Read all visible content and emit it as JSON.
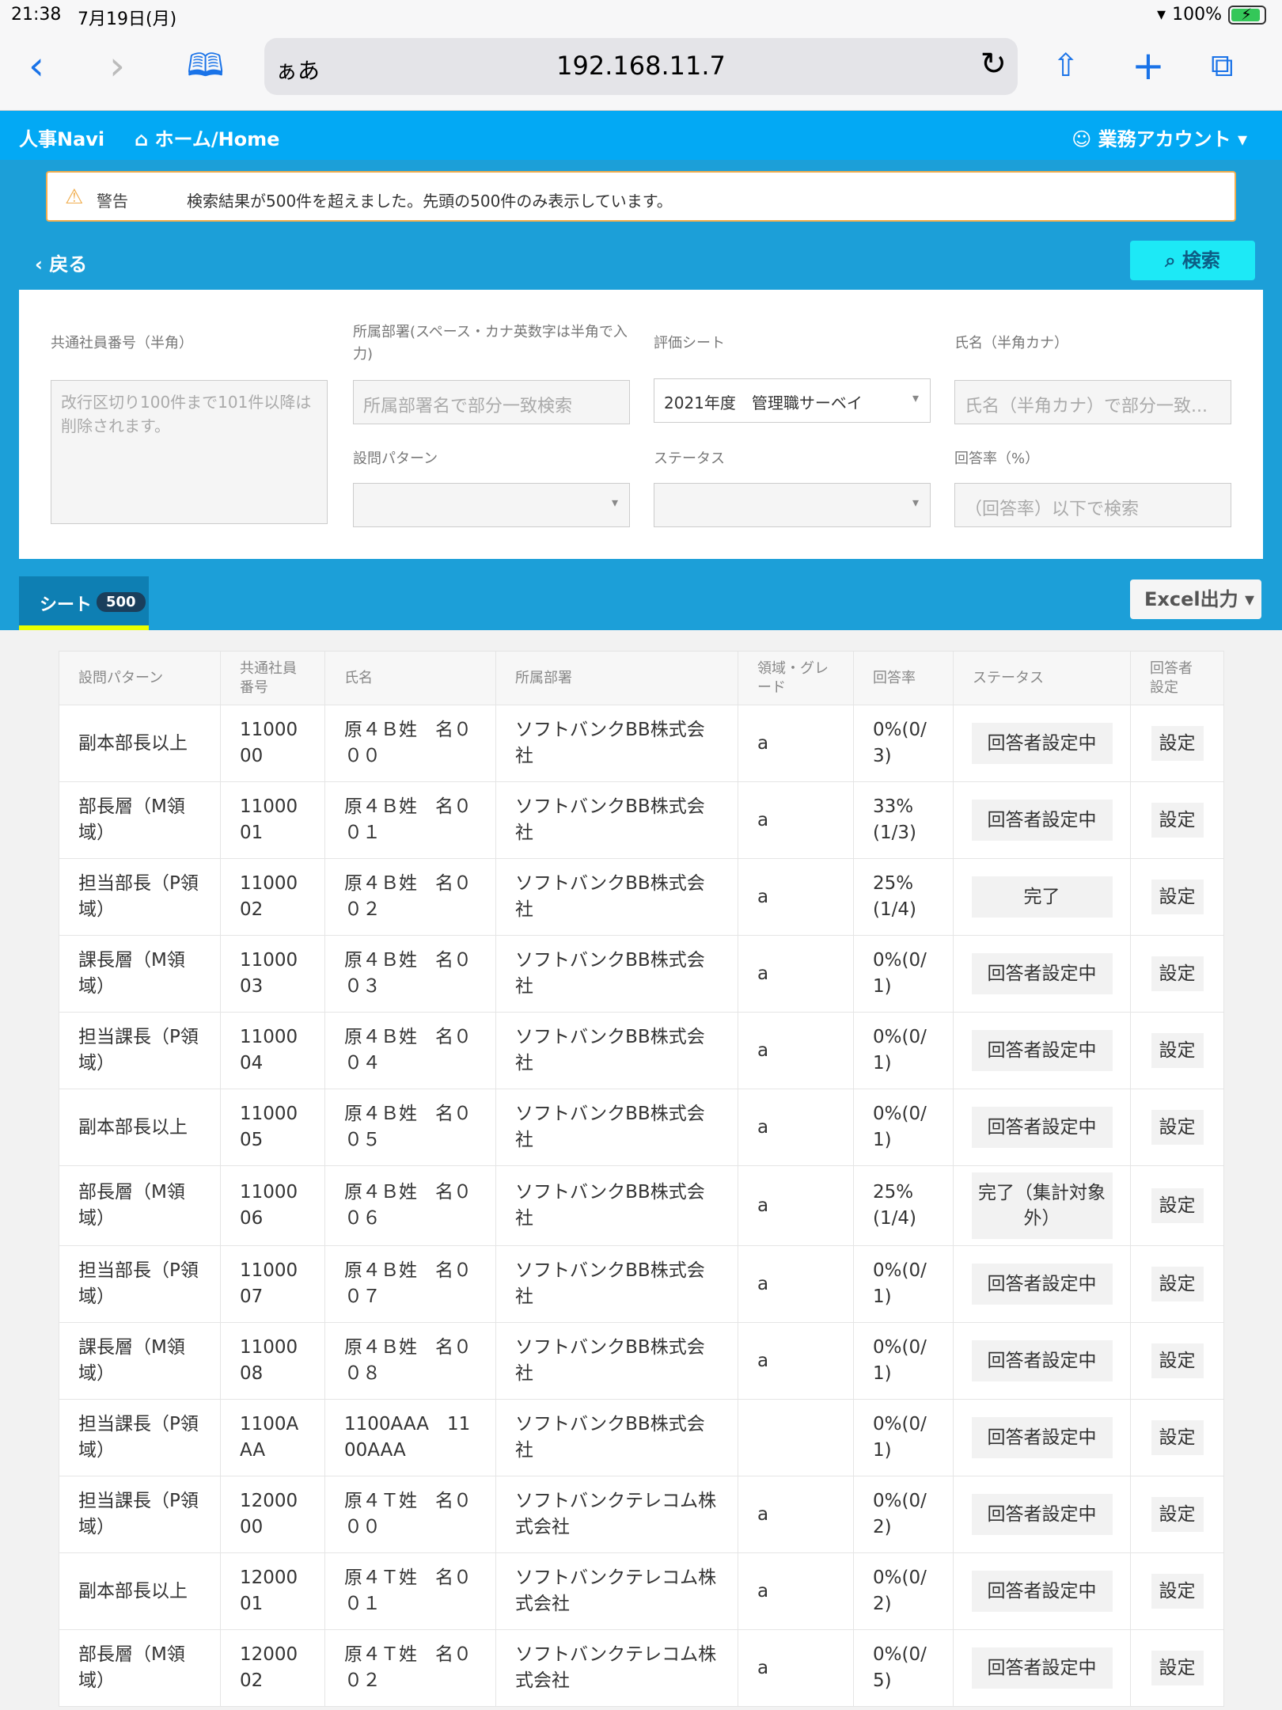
{
  "statusbar": {
    "time": "21:38",
    "date": "7月19日(月)",
    "battery": "100%"
  },
  "browser": {
    "aa": "ぁあ",
    "url": "192.168.11.7"
  },
  "nav": {
    "brand": "人事Navi",
    "home": "ホーム/Home",
    "account": "業務アカウント"
  },
  "alert": {
    "label": "警告",
    "message": "検索結果が500件を超えました。先頭の500件のみ表示しています。"
  },
  "actions": {
    "back": "戻る",
    "search": "検索",
    "excel": "Excel出力"
  },
  "form": {
    "employee_no": {
      "label": "共通社員番号（半角）",
      "placeholder": "改行区切り100件まで101件以降は削除されます。"
    },
    "department": {
      "label": "所属部署(スペース・カナ英数字は半角で入力)",
      "placeholder": "所属部署名で部分一致検索"
    },
    "sheet": {
      "label": "評価シート",
      "value": "2021年度　管理職サーベイ"
    },
    "name": {
      "label": "氏名（半角カナ）",
      "placeholder": "氏名（半角カナ）で部分一致..."
    },
    "pattern": {
      "label": "設問パターン",
      "value": ""
    },
    "status": {
      "label": "ステータス",
      "value": ""
    },
    "rate": {
      "label": "回答率（%）",
      "placeholder": "（回答率）以下で検索"
    }
  },
  "tab": {
    "label": "シート",
    "count": "500"
  },
  "table": {
    "headers": [
      "設問パターン",
      "共通社員番号",
      "氏名",
      "所属部署",
      "領域・グレード",
      "回答率",
      "ステータス",
      "回答者設定"
    ],
    "setting_label": "設定",
    "rows": [
      {
        "pattern": "副本部長以上",
        "emp": "1100000",
        "name": "原４Ｂ姓　名０００",
        "dept": "ソフトバンクBB株式会社",
        "grade": "a",
        "rate": "0%(0/3)",
        "status": "回答者設定中"
      },
      {
        "pattern": "部長層（M領域）",
        "emp": "1100001",
        "name": "原４Ｂ姓　名００１",
        "dept": "ソフトバンクBB株式会社",
        "grade": "a",
        "rate": "33%(1/3)",
        "status": "回答者設定中"
      },
      {
        "pattern": "担当部長（P領域）",
        "emp": "1100002",
        "name": "原４Ｂ姓　名００２",
        "dept": "ソフトバンクBB株式会社",
        "grade": "a",
        "rate": "25%(1/4)",
        "status": "完了"
      },
      {
        "pattern": "課長層（M領域）",
        "emp": "1100003",
        "name": "原４Ｂ姓　名００３",
        "dept": "ソフトバンクBB株式会社",
        "grade": "a",
        "rate": "0%(0/1)",
        "status": "回答者設定中"
      },
      {
        "pattern": "担当課長（P領域）",
        "emp": "1100004",
        "name": "原４Ｂ姓　名００４",
        "dept": "ソフトバンクBB株式会社",
        "grade": "a",
        "rate": "0%(0/1)",
        "status": "回答者設定中"
      },
      {
        "pattern": "副本部長以上",
        "emp": "1100005",
        "name": "原４Ｂ姓　名００５",
        "dept": "ソフトバンクBB株式会社",
        "grade": "a",
        "rate": "0%(0/1)",
        "status": "回答者設定中"
      },
      {
        "pattern": "部長層（M領域）",
        "emp": "1100006",
        "name": "原４Ｂ姓　名００６",
        "dept": "ソフトバンクBB株式会社",
        "grade": "a",
        "rate": "25%(1/4)",
        "status": "完了（集計対象外）"
      },
      {
        "pattern": "担当部長（P領域）",
        "emp": "1100007",
        "name": "原４Ｂ姓　名００７",
        "dept": "ソフトバンクBB株式会社",
        "grade": "a",
        "rate": "0%(0/1)",
        "status": "回答者設定中"
      },
      {
        "pattern": "課長層（M領域）",
        "emp": "1100008",
        "name": "原４Ｂ姓　名００８",
        "dept": "ソフトバンクBB株式会社",
        "grade": "a",
        "rate": "0%(0/1)",
        "status": "回答者設定中"
      },
      {
        "pattern": "担当課長（P領域）",
        "emp": "1100AAA",
        "name": "1100AAA　1100AAA",
        "dept": "ソフトバンクBB株式会社",
        "grade": "",
        "rate": "0%(0/1)",
        "status": "回答者設定中"
      },
      {
        "pattern": "担当課長（P領域）",
        "emp": "1200000",
        "name": "原４Ｔ姓　名０００",
        "dept": "ソフトバンクテレコム株式会社",
        "grade": "a",
        "rate": "0%(0/2)",
        "status": "回答者設定中"
      },
      {
        "pattern": "副本部長以上",
        "emp": "1200001",
        "name": "原４Ｔ姓　名００１",
        "dept": "ソフトバンクテレコム株式会社",
        "grade": "a",
        "rate": "0%(0/2)",
        "status": "回答者設定中"
      },
      {
        "pattern": "部長層（M領域）",
        "emp": "1200002",
        "name": "原４Ｔ姓　名００２",
        "dept": "ソフトバンクテレコム株式会社",
        "grade": "a",
        "rate": "0%(0/5)",
        "status": "回答者設定中"
      }
    ]
  }
}
